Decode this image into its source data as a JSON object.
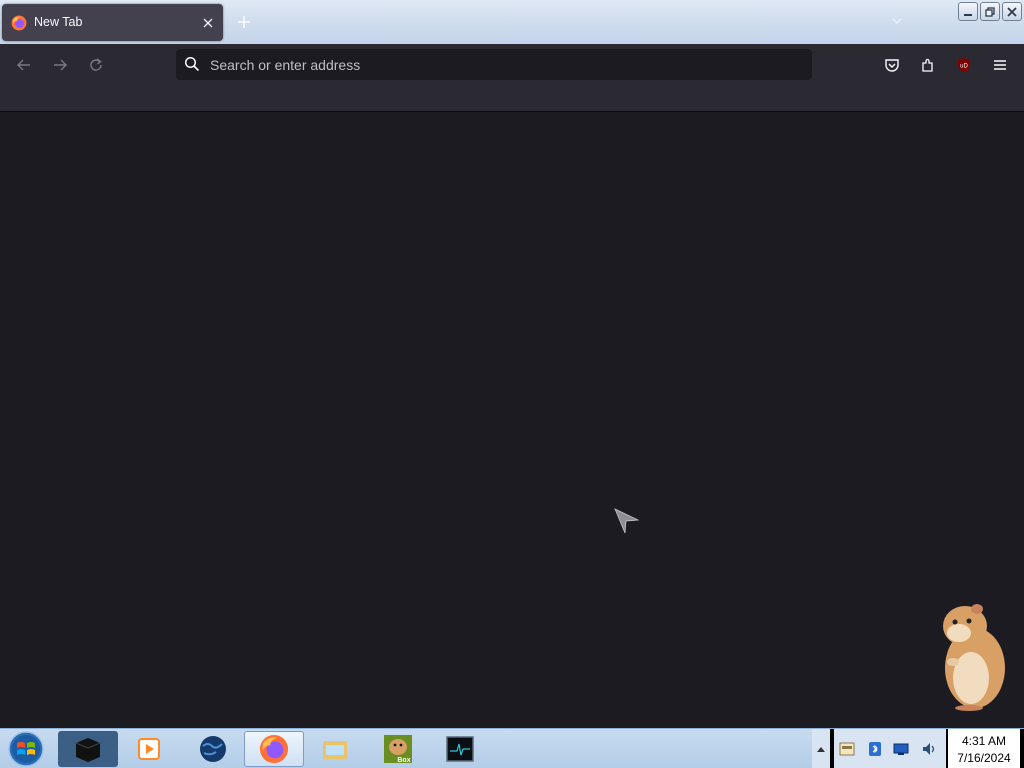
{
  "browser": {
    "tab": {
      "title": "New Tab",
      "favicon": "firefox-icon"
    },
    "new_tab_icon": "plus-icon",
    "list_tabs_icon": "chevron-down-icon",
    "urlbar": {
      "placeholder": "Search or enter address",
      "value": ""
    },
    "nav_icons": [
      "back-arrow-icon",
      "forward-arrow-icon",
      "reload-icon"
    ],
    "toolbar_icons": [
      "pocket-icon",
      "extensions-icon",
      "ublock-origin-icon",
      "menu-icon"
    ],
    "ublock_badge": "uD"
  },
  "window_controls": [
    "minimize-icon",
    "restore-icon",
    "close-icon"
  ],
  "taskbar": {
    "start_icon": "windows-logo-icon",
    "apps": [
      {
        "name": "terminal-icon"
      },
      {
        "name": "media-player-icon"
      },
      {
        "name": "globe-icon"
      },
      {
        "name": "firefox-icon",
        "active": true
      },
      {
        "name": "file-explorer-icon"
      },
      {
        "name": "box-game-icon",
        "label": "Box"
      },
      {
        "name": "monitor-icon"
      }
    ],
    "tray_icons": [
      "tray-app-icon",
      "tray-bluetooth-icon",
      "tray-network-icon",
      "tray-volume-icon"
    ],
    "clock": {
      "time": "4:31 AM",
      "date": "7/16/2024"
    }
  },
  "colors": {
    "toolbar": "#2b2a33",
    "content": "#1c1b22",
    "tab_active": "#42414d",
    "taskbar": "#b3cde8"
  }
}
